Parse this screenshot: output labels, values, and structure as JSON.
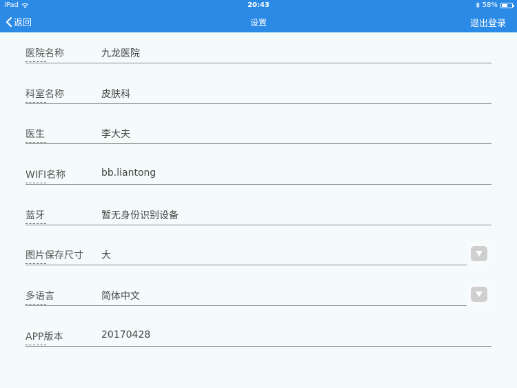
{
  "status": {
    "device": "iPad",
    "time": "20:43",
    "battery": "58%",
    "battery_level": 0.58
  },
  "nav": {
    "back_label": "返回",
    "title": "设置",
    "logout_label": "退出登录"
  },
  "fields": [
    {
      "label": "医院名称",
      "value": "九龙医院"
    },
    {
      "label": "科室名称",
      "value": "皮肤科"
    },
    {
      "label": "医生",
      "value": "李大夫"
    },
    {
      "label": "WIFI名称",
      "value": "bb.liantong"
    },
    {
      "label": "蓝牙",
      "value": "暂无身份识别设备"
    },
    {
      "label": "图片保存尺寸",
      "value": "大"
    },
    {
      "label": "多语言",
      "value": "简体中文"
    },
    {
      "label": "APP版本",
      "value": "20170428"
    }
  ]
}
